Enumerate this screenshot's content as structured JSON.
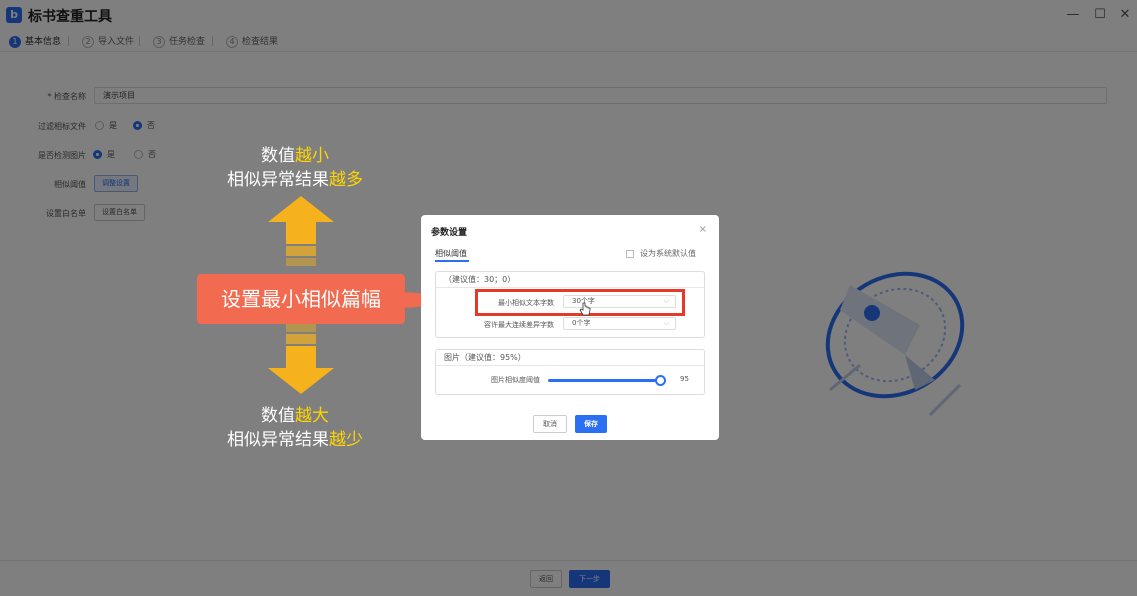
{
  "app": {
    "title": "标书查重工具",
    "logo": "b",
    "accent": "#2b6ff2"
  },
  "window": {
    "minimize": "—",
    "maximize": "☐",
    "close": "✕"
  },
  "steps": [
    {
      "num": "1",
      "label": "基本信息"
    },
    {
      "num": "2",
      "label": "导入文件"
    },
    {
      "num": "3",
      "label": "任务检查"
    },
    {
      "num": "4",
      "label": "检查结果"
    }
  ],
  "form": {
    "name_label": "* 检查名称",
    "name_value": "演示项目",
    "filter_label": "过滤相标文件",
    "filter_yes": "是",
    "filter_no": "否",
    "image_label": "是否检测图片",
    "image_yes": "是",
    "image_no": "否",
    "threshold_label": "相似阈值",
    "threshold_btn": "调整设置",
    "whitelist_label": "设置白名单",
    "whitelist_btn": "设置白名单"
  },
  "footer": {
    "back": "返回",
    "next": "下一步"
  },
  "annotations": {
    "top_line1_prefix": "数值",
    "top_line1_hl": "越小",
    "top_line2_prefix": "相似异常结果",
    "top_line2_hl": "越多",
    "banner": "设置最小相似篇幅",
    "bottom_line1_prefix": "数值",
    "bottom_line1_hl": "越大",
    "bottom_line2_prefix": "相似异常结果",
    "bottom_line2_hl": "越少",
    "highlight_color": "#ffd400",
    "banner_color": "#f26a4f",
    "arrow_color": "#f5b21c"
  },
  "modal": {
    "title": "参数设置",
    "close": "×",
    "tab": "相似阈值",
    "default_checkbox": "设为系统默认值",
    "text_section": {
      "header": "（建议值：30；0）",
      "min_label": "最小相似文本字数",
      "min_value": "30个字",
      "max_label": "容许最大连续差异字数",
      "max_value": "0个字"
    },
    "image_section": {
      "header": "图片（建议值：95%）",
      "similarity_label": "图片相似度阈值",
      "similarity_value": "95",
      "slider_fraction": 0.95
    },
    "cancel": "取消",
    "save": "保存"
  }
}
